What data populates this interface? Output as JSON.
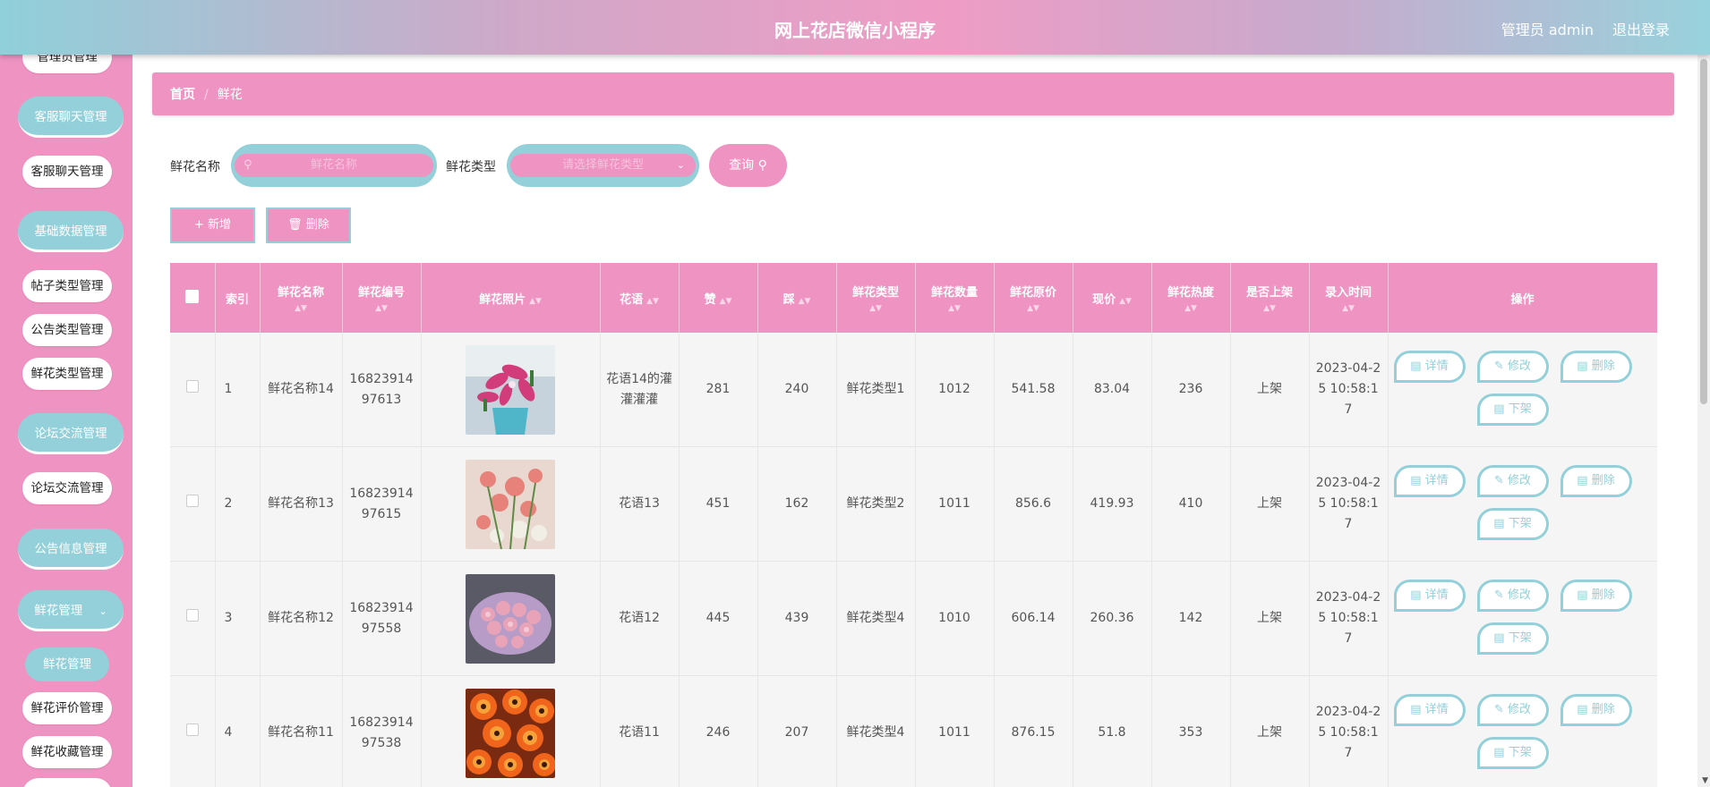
{
  "header": {
    "title": "网上花店微信小程序",
    "admin": "管理员 admin",
    "logout": "退出登录"
  },
  "sidebar": {
    "items": [
      {
        "label": "管理员管理",
        "type": "item"
      },
      {
        "label": "客服聊天管理",
        "type": "group"
      },
      {
        "label": "客服聊天管理",
        "type": "item"
      },
      {
        "label": "基础数据管理",
        "type": "group"
      },
      {
        "label": "帖子类型管理",
        "type": "item"
      },
      {
        "label": "公告类型管理",
        "type": "item"
      },
      {
        "label": "鲜花类型管理",
        "type": "item"
      },
      {
        "label": "论坛交流管理",
        "type": "group"
      },
      {
        "label": "论坛交流管理",
        "type": "item"
      },
      {
        "label": "公告信息管理",
        "type": "group"
      },
      {
        "label": "鲜花管理",
        "type": "group-open"
      },
      {
        "label": "鲜花管理",
        "type": "active"
      },
      {
        "label": "鲜花评价管理",
        "type": "item"
      },
      {
        "label": "鲜花收藏管理",
        "type": "item"
      }
    ]
  },
  "breadcrumb": {
    "home": "首页",
    "sep": "/",
    "current": "鲜花"
  },
  "search": {
    "name_label": "鲜花名称",
    "name_placeholder": "鲜花名称",
    "type_label": "鲜花类型",
    "type_placeholder": "请选择鲜花类型",
    "query_label": "查询"
  },
  "toolbar": {
    "add_label": "新增",
    "delete_label": "删除"
  },
  "table": {
    "columns": [
      "索引",
      "鲜花名称",
      "鲜花编号",
      "鲜花照片",
      "花语",
      "赞",
      "踩",
      "鲜花类型",
      "鲜花数量",
      "鲜花原价",
      "现价",
      "鲜花热度",
      "是否上架",
      "录入时间",
      "操作"
    ],
    "rows": [
      {
        "index": "1",
        "name": "鲜花名称14",
        "code": "1682391497613",
        "photo": "lily",
        "language": "花语14的灌灌灌灌",
        "up": "281",
        "down": "240",
        "type": "鲜花类型1",
        "qty": "1012",
        "orig": "541.58",
        "price": "83.04",
        "heat": "236",
        "on": "上架",
        "time": "2023-04-25 10:58:17"
      },
      {
        "index": "2",
        "name": "鲜花名称13",
        "code": "1682391497615",
        "photo": "carnation",
        "language": "花语13",
        "up": "451",
        "down": "162",
        "type": "鲜花类型2",
        "qty": "1011",
        "orig": "856.6",
        "price": "419.93",
        "heat": "410",
        "on": "上架",
        "time": "2023-04-25 10:58:17"
      },
      {
        "index": "3",
        "name": "鲜花名称12",
        "code": "1682391497558",
        "photo": "bouquet",
        "language": "花语12",
        "up": "445",
        "down": "439",
        "type": "鲜花类型4",
        "qty": "1010",
        "orig": "606.14",
        "price": "260.36",
        "heat": "142",
        "on": "上架",
        "time": "2023-04-25 10:58:17"
      },
      {
        "index": "4",
        "name": "鲜花名称11",
        "code": "1682391497538",
        "photo": "gerbera",
        "language": "花语11",
        "up": "246",
        "down": "207",
        "type": "鲜花类型4",
        "qty": "1011",
        "orig": "876.15",
        "price": "51.8",
        "heat": "353",
        "on": "上架",
        "time": "2023-04-25 10:58:17"
      }
    ],
    "actions": {
      "detail": "详情",
      "edit": "修改",
      "delete": "删除",
      "off": "下架"
    }
  },
  "colors": {
    "pink": "#ef93c2",
    "teal": "#93d0d9"
  }
}
